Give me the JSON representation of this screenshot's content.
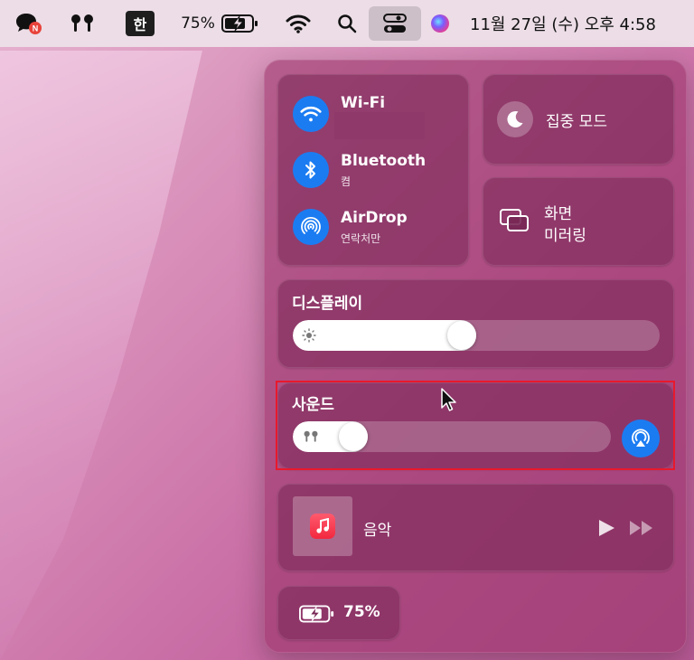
{
  "menubar": {
    "battery_percent": "75%",
    "ime_label": "한",
    "datetime": "11월 27일 (수) 오후 4:58",
    "badge_letter": "N"
  },
  "control_center": {
    "wifi": {
      "label": "Wi-Fi"
    },
    "bluetooth": {
      "label": "Bluetooth",
      "status": "켬"
    },
    "airdrop": {
      "label": "AirDrop",
      "status": "연락처만"
    },
    "focus": {
      "label": "집중 모드"
    },
    "mirroring": {
      "label_line1": "화면",
      "label_line2": "미러링"
    },
    "display": {
      "label": "디스플레이",
      "brightness": 0.46
    },
    "sound": {
      "label": "사운드",
      "volume": 0.19
    },
    "music": {
      "label": "음악"
    },
    "battery": {
      "percent": "75%"
    }
  },
  "colors": {
    "accent_blue": "#1b7cf2",
    "highlight_red": "#e8192c"
  }
}
